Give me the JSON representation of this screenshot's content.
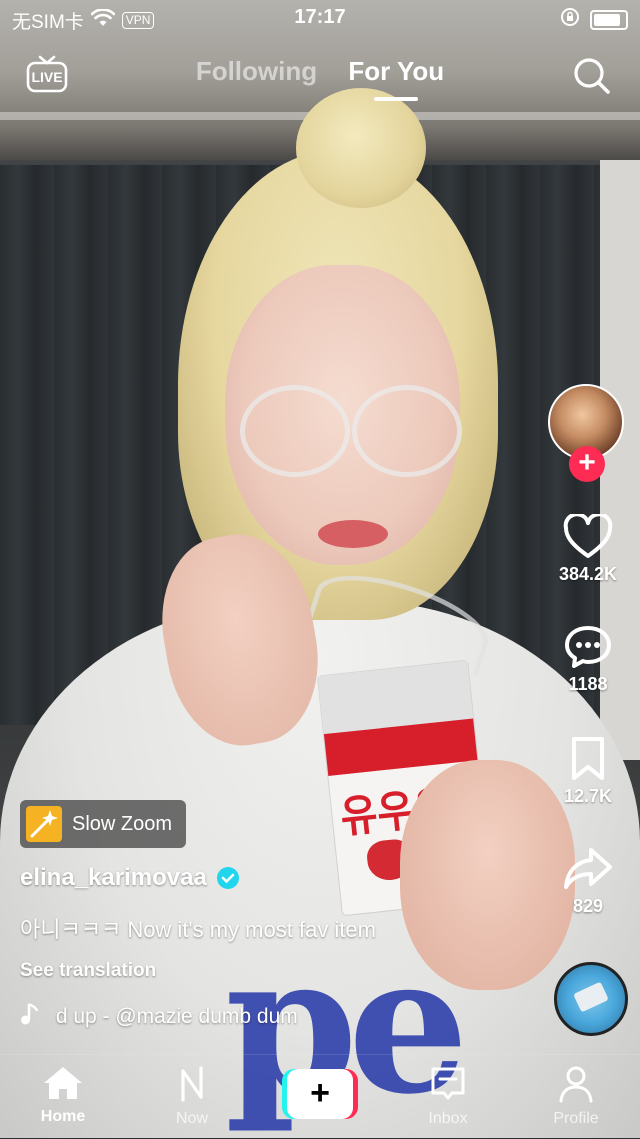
{
  "status_bar": {
    "carrier": "无SIM卡",
    "vpn": "VPN",
    "time": "17:17"
  },
  "top_nav": {
    "live_label": "LIVE",
    "tabs": [
      "Following",
      "For You"
    ],
    "active_tab": "For You"
  },
  "actions": {
    "likes": "384.2K",
    "comments": "1188",
    "saves": "12.7K",
    "shares": "829"
  },
  "video_info": {
    "effect": "Slow Zoom",
    "username": "elina_karimovaa",
    "caption": "아니ㅋㅋㅋ  Now it's my most fav item",
    "see_translation": "See translation",
    "music": " d up - @mazie     dumb dum"
  },
  "bottom_nav": {
    "items": [
      "Home",
      "Now",
      "Inbox",
      "Profile"
    ],
    "active": "Home"
  },
  "colors": {
    "brand_red": "#fe2c55",
    "brand_cyan": "#25f4ee",
    "verified": "#20d5ec"
  }
}
